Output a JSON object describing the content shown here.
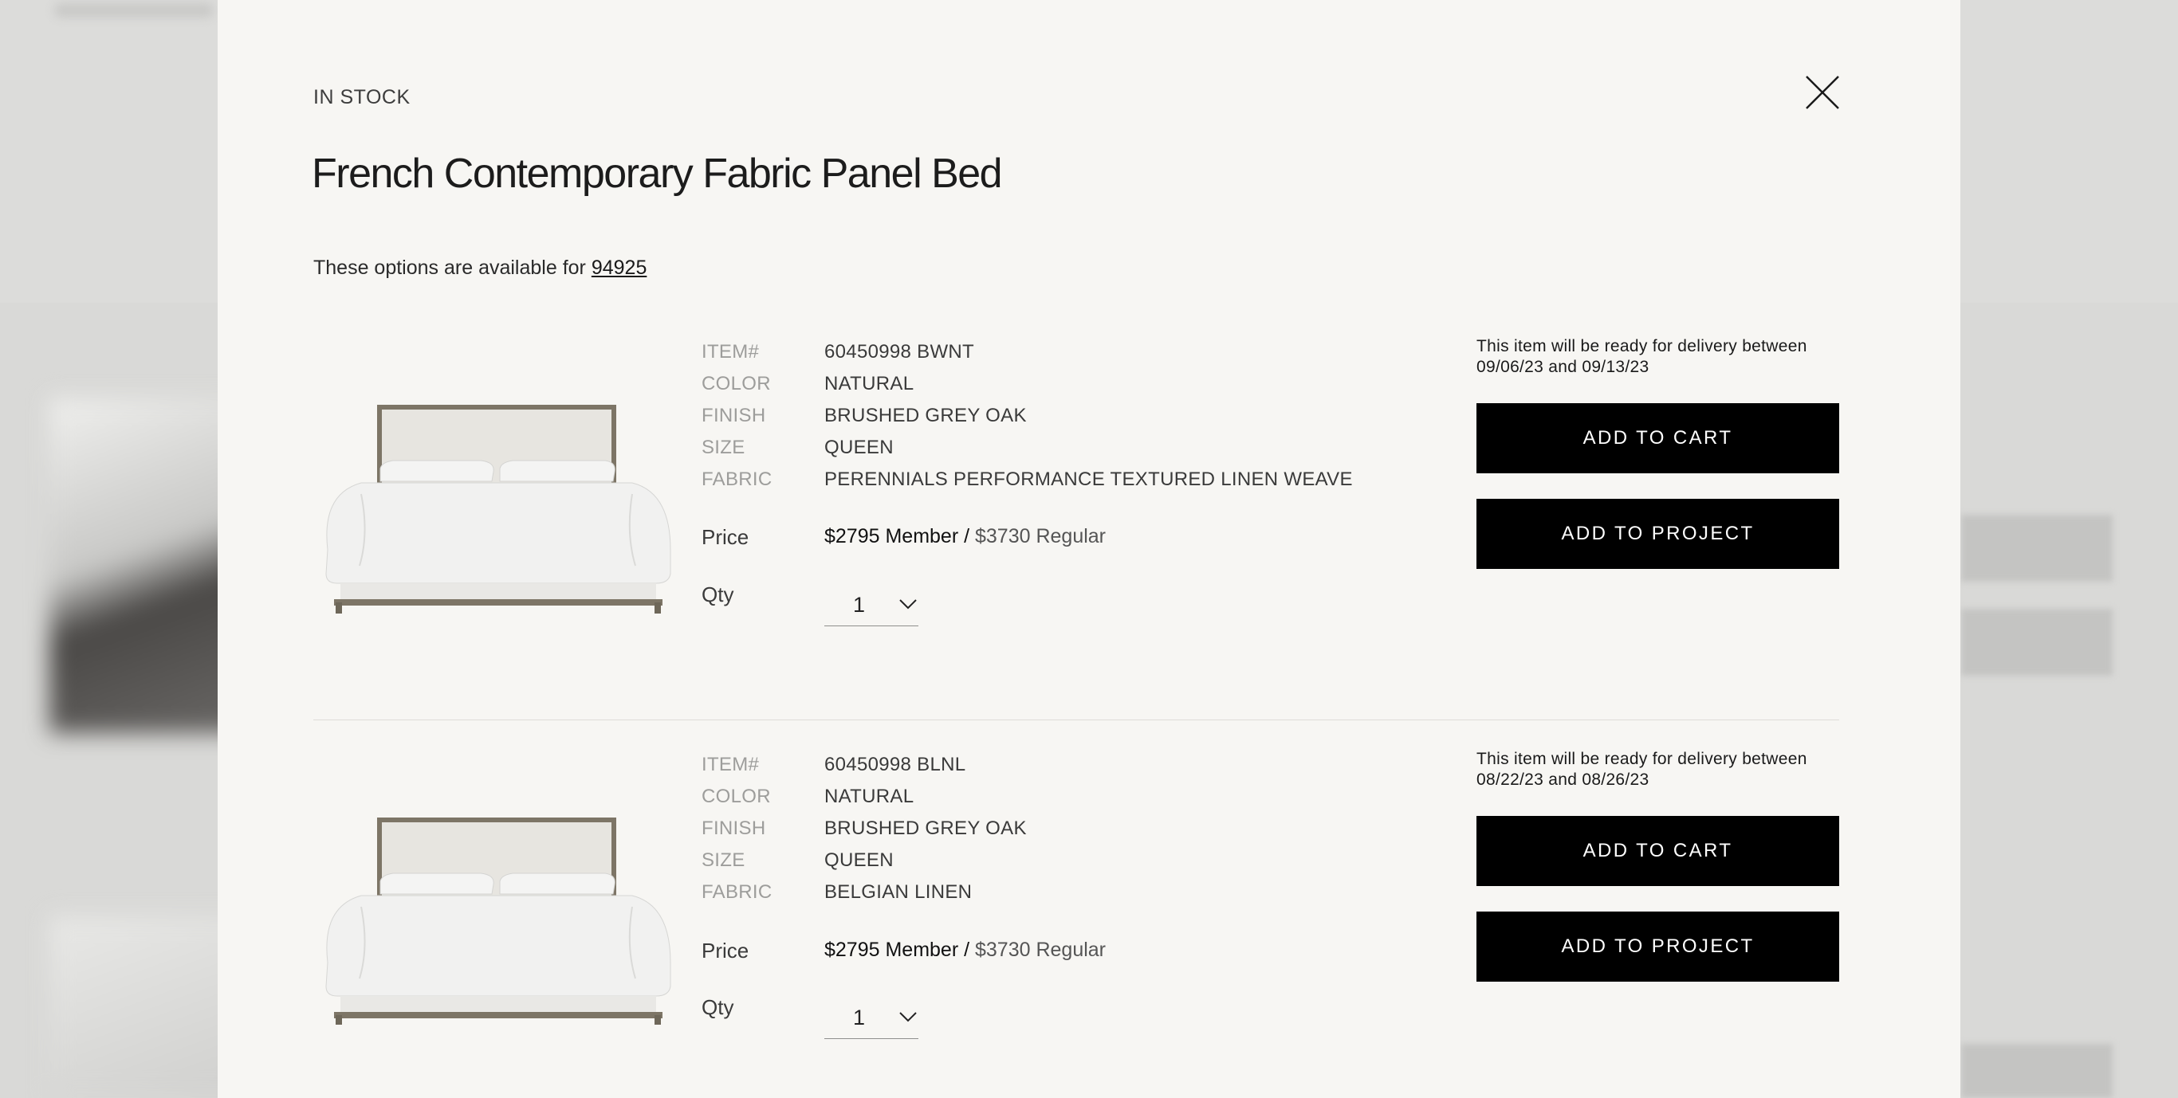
{
  "modal": {
    "stock_status": "IN STOCK",
    "title": "French Contemporary Fabric Panel Bed",
    "availability_text": "These options are available for ",
    "zip_code": "94925"
  },
  "labels": {
    "item": "ITEM#",
    "color": "COLOR",
    "finish": "FINISH",
    "size": "SIZE",
    "fabric": "FABRIC",
    "price": "Price",
    "qty": "Qty",
    "add_to_cart": "ADD TO CART",
    "add_to_project": "ADD TO PROJECT"
  },
  "options": [
    {
      "item": "60450998 BWNT",
      "color": "NATURAL",
      "finish": "BRUSHED GREY OAK",
      "size": "QUEEN",
      "fabric": "PERENNIALS PERFORMANCE TEXTURED LINEN WEAVE",
      "price_member": "$2795 Member /",
      "price_regular": " $3730 Regular",
      "qty": "1",
      "delivery_line1": "This item will be ready for delivery between",
      "delivery_line2": "09/06/23 and 09/13/23"
    },
    {
      "item": "60450998 BLNL",
      "color": "NATURAL",
      "finish": "BRUSHED GREY OAK",
      "size": "QUEEN",
      "fabric": "BELGIAN LINEN",
      "price_member": "$2795 Member /",
      "price_regular": " $3730 Regular",
      "qty": "1",
      "delivery_line1": "This item will be ready for delivery between",
      "delivery_line2": "08/22/23 and 08/26/23"
    }
  ],
  "icons": {
    "close": "close-icon",
    "chevron": "chevron-down-icon",
    "product": "bed-image"
  },
  "colors": {
    "modal_background": "#f7f6f3",
    "button_background": "#000000",
    "button_text": "#ffffff",
    "label_gray": "#9d9d9b"
  }
}
